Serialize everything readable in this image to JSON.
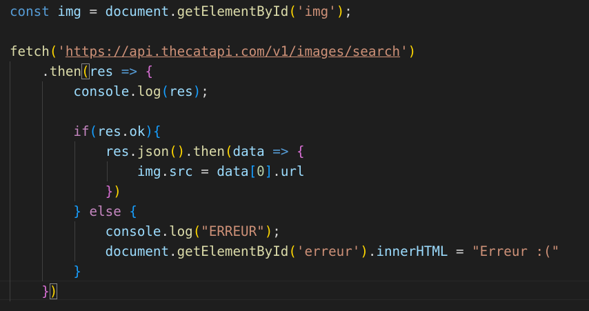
{
  "editor": {
    "language": "javascript",
    "colors": {
      "background": "#1e1e1e",
      "keyword": "#569cd6",
      "control": "#c586c0",
      "variable": "#9cdcfe",
      "function": "#dcdcaa",
      "string": "#ce9178",
      "number": "#b5cea8",
      "object": "#4ec9b0",
      "text": "#d4d4d4"
    },
    "lines": [
      {
        "tokens": [
          {
            "t": "const",
            "c": "kw"
          },
          {
            "t": " ",
            "c": "punc"
          },
          {
            "t": "img",
            "c": "var"
          },
          {
            "t": " = ",
            "c": "punc"
          },
          {
            "t": "document",
            "c": "var"
          },
          {
            "t": ".",
            "c": "punc"
          },
          {
            "t": "getElementById",
            "c": "fn"
          },
          {
            "t": "(",
            "c": "brk1"
          },
          {
            "t": "'img'",
            "c": "str"
          },
          {
            "t": ")",
            "c": "brk1"
          },
          {
            "t": ";",
            "c": "punc"
          }
        ]
      },
      {
        "tokens": []
      },
      {
        "tokens": [
          {
            "t": "fetch",
            "c": "fn"
          },
          {
            "t": "(",
            "c": "brk1"
          },
          {
            "t": "'",
            "c": "str"
          },
          {
            "t": "https://api.thecatapi.com/v1/images/search",
            "c": "str url"
          },
          {
            "t": "'",
            "c": "str"
          },
          {
            "t": ")",
            "c": "brk1"
          }
        ]
      },
      {
        "tokens": [
          {
            "t": "    .",
            "c": "punc"
          },
          {
            "t": "then",
            "c": "fn"
          },
          {
            "t": "(",
            "c": "brk1 bracket-box"
          },
          {
            "t": "res",
            "c": "var"
          },
          {
            "t": " ",
            "c": "punc"
          },
          {
            "t": "=>",
            "c": "kw"
          },
          {
            "t": " ",
            "c": "punc"
          },
          {
            "t": "{",
            "c": "brk2"
          }
        ]
      },
      {
        "tokens": [
          {
            "t": "        ",
            "c": "punc"
          },
          {
            "t": "console",
            "c": "var"
          },
          {
            "t": ".",
            "c": "punc"
          },
          {
            "t": "log",
            "c": "fn"
          },
          {
            "t": "(",
            "c": "brk3"
          },
          {
            "t": "res",
            "c": "var"
          },
          {
            "t": ")",
            "c": "brk3"
          },
          {
            "t": ";",
            "c": "punc"
          }
        ]
      },
      {
        "tokens": []
      },
      {
        "tokens": [
          {
            "t": "        ",
            "c": "punc"
          },
          {
            "t": "if",
            "c": "ctrl"
          },
          {
            "t": "(",
            "c": "brk3"
          },
          {
            "t": "res",
            "c": "var"
          },
          {
            "t": ".",
            "c": "punc"
          },
          {
            "t": "ok",
            "c": "var"
          },
          {
            "t": ")",
            "c": "brk3"
          },
          {
            "t": "{",
            "c": "brk3"
          }
        ]
      },
      {
        "tokens": [
          {
            "t": "            ",
            "c": "punc"
          },
          {
            "t": "res",
            "c": "var"
          },
          {
            "t": ".",
            "c": "punc"
          },
          {
            "t": "json",
            "c": "fn"
          },
          {
            "t": "()",
            "c": "brk1"
          },
          {
            "t": ".",
            "c": "punc"
          },
          {
            "t": "then",
            "c": "fn"
          },
          {
            "t": "(",
            "c": "brk1"
          },
          {
            "t": "data",
            "c": "var"
          },
          {
            "t": " ",
            "c": "punc"
          },
          {
            "t": "=>",
            "c": "kw"
          },
          {
            "t": " ",
            "c": "punc"
          },
          {
            "t": "{",
            "c": "brk2"
          }
        ]
      },
      {
        "tokens": [
          {
            "t": "                ",
            "c": "punc"
          },
          {
            "t": "img",
            "c": "var"
          },
          {
            "t": ".",
            "c": "punc"
          },
          {
            "t": "src",
            "c": "var"
          },
          {
            "t": " = ",
            "c": "punc"
          },
          {
            "t": "data",
            "c": "var"
          },
          {
            "t": "[",
            "c": "brk3"
          },
          {
            "t": "0",
            "c": "num"
          },
          {
            "t": "]",
            "c": "brk3"
          },
          {
            "t": ".",
            "c": "punc"
          },
          {
            "t": "url",
            "c": "var"
          }
        ]
      },
      {
        "tokens": [
          {
            "t": "            ",
            "c": "punc"
          },
          {
            "t": "}",
            "c": "brk2"
          },
          {
            "t": ")",
            "c": "brk1"
          }
        ]
      },
      {
        "tokens": [
          {
            "t": "        ",
            "c": "punc"
          },
          {
            "t": "}",
            "c": "brk3"
          },
          {
            "t": " ",
            "c": "punc"
          },
          {
            "t": "else",
            "c": "ctrl"
          },
          {
            "t": " ",
            "c": "punc"
          },
          {
            "t": "{",
            "c": "brk3"
          }
        ]
      },
      {
        "tokens": [
          {
            "t": "            ",
            "c": "punc"
          },
          {
            "t": "console",
            "c": "var"
          },
          {
            "t": ".",
            "c": "punc"
          },
          {
            "t": "log",
            "c": "fn"
          },
          {
            "t": "(",
            "c": "brk1"
          },
          {
            "t": "\"ERREUR\"",
            "c": "str"
          },
          {
            "t": ")",
            "c": "brk1"
          },
          {
            "t": ";",
            "c": "punc"
          }
        ]
      },
      {
        "tokens": [
          {
            "t": "            ",
            "c": "punc"
          },
          {
            "t": "document",
            "c": "var"
          },
          {
            "t": ".",
            "c": "punc"
          },
          {
            "t": "getElementById",
            "c": "fn"
          },
          {
            "t": "(",
            "c": "brk1"
          },
          {
            "t": "'erreur'",
            "c": "str"
          },
          {
            "t": ")",
            "c": "brk1"
          },
          {
            "t": ".",
            "c": "punc"
          },
          {
            "t": "innerHTML",
            "c": "var"
          },
          {
            "t": " = ",
            "c": "punc"
          },
          {
            "t": "\"Erreur :(\"",
            "c": "str"
          }
        ]
      },
      {
        "tokens": [
          {
            "t": "        ",
            "c": "punc"
          },
          {
            "t": "}",
            "c": "brk3"
          }
        ]
      },
      {
        "tokens": [
          {
            "t": "    ",
            "c": "punc"
          },
          {
            "t": "}",
            "c": "brk2"
          },
          {
            "t": ")",
            "c": "brk1 bracket-box"
          }
        ]
      }
    ]
  }
}
